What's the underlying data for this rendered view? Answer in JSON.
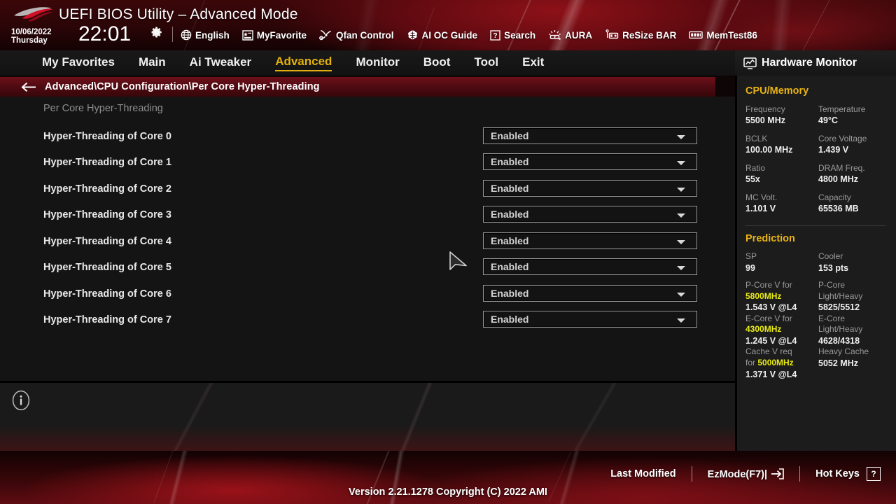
{
  "header": {
    "title": "UEFI BIOS Utility – Advanced Mode",
    "date": "10/06/2022",
    "weekday": "Thursday",
    "time": "22:01",
    "gear_icon": "gear-icon",
    "tools": [
      {
        "label": "English",
        "icon": "globe-icon"
      },
      {
        "label": "MyFavorite",
        "icon": "star-list-icon"
      },
      {
        "label": "Qfan Control",
        "icon": "fan-icon"
      },
      {
        "label": "AI OC Guide",
        "icon": "brain-icon"
      },
      {
        "label": "Search",
        "icon": "question-box-icon"
      },
      {
        "label": "AURA",
        "icon": "aura-light-icon"
      },
      {
        "label": "ReSize BAR",
        "icon": "resize-bar-icon"
      },
      {
        "label": "MemTest86",
        "icon": "memory-icon"
      }
    ]
  },
  "tabs": [
    {
      "label": "My Favorites",
      "active": false
    },
    {
      "label": "Main",
      "active": false
    },
    {
      "label": "Ai Tweaker",
      "active": false
    },
    {
      "label": "Advanced",
      "active": true
    },
    {
      "label": "Monitor",
      "active": false
    },
    {
      "label": "Boot",
      "active": false
    },
    {
      "label": "Tool",
      "active": false
    },
    {
      "label": "Exit",
      "active": false
    }
  ],
  "breadcrumb": {
    "back_icon": "back-arrow-icon",
    "path": "Advanced\\CPU Configuration\\Per Core Hyper-Threading"
  },
  "main": {
    "section_title": "Per Core Hyper-Threading",
    "info_icon": "info-circle-icon",
    "rows": [
      {
        "label": "Hyper-Threading of Core 0",
        "value": "Enabled"
      },
      {
        "label": "Hyper-Threading of Core 1",
        "value": "Enabled"
      },
      {
        "label": "Hyper-Threading of Core 2",
        "value": "Enabled"
      },
      {
        "label": "Hyper-Threading of Core 3",
        "value": "Enabled"
      },
      {
        "label": "Hyper-Threading of Core 4",
        "value": "Enabled"
      },
      {
        "label": "Hyper-Threading of Core 5",
        "value": "Enabled"
      },
      {
        "label": "Hyper-Threading of Core 6",
        "value": "Enabled"
      },
      {
        "label": "Hyper-Threading of Core 7",
        "value": "Enabled"
      }
    ]
  },
  "hardware_monitor": {
    "title": "Hardware Monitor",
    "icon": "monitor-icon",
    "cpu_memory": {
      "section": "CPU/Memory",
      "items": [
        {
          "key": "Frequency",
          "value": "5500 MHz"
        },
        {
          "key": "Temperature",
          "value": "49°C"
        },
        {
          "key": "BCLK",
          "value": "100.00 MHz"
        },
        {
          "key": "Core Voltage",
          "value": "1.439 V"
        },
        {
          "key": "Ratio",
          "value": "55x"
        },
        {
          "key": "DRAM Freq.",
          "value": "4800 MHz"
        },
        {
          "key": "MC Volt.",
          "value": "1.101 V"
        },
        {
          "key": "Capacity",
          "value": "65536 MB"
        }
      ]
    },
    "prediction": {
      "section": "Prediction",
      "sp_key": "SP",
      "sp_value": "99",
      "cooler_key": "Cooler",
      "cooler_value": "153 pts",
      "pcore_key_a": "P-Core V for",
      "pcore_key_b": "5800MHz",
      "pcore_value": "1.543 V @L4",
      "pcore_light_a": "P-Core",
      "pcore_light_b": "Light/Heavy",
      "pcore_light_value": "5825/5512",
      "ecore_key_a": "E-Core V for",
      "ecore_key_b": "4300MHz",
      "ecore_value": "1.245 V @L4",
      "ecore_light_a": "E-Core",
      "ecore_light_b": "Light/Heavy",
      "ecore_light_value": "4628/4318",
      "cache_key_a": "Cache V req",
      "cache_key_b": "for",
      "cache_key_c": "5000MHz",
      "cache_value": "1.371 V @L4",
      "heavy_cache_key": "Heavy Cache",
      "heavy_cache_value": "5052 MHz"
    }
  },
  "footer": {
    "last_modified": "Last Modified",
    "ezmode": "EzMode(F7)|",
    "ezmode_icon": "exit-arrow-icon",
    "hot_keys": "Hot Keys",
    "hot_keys_badge": "?",
    "version": "Version 2.21.1278 Copyright (C) 2022 AMI"
  },
  "colors": {
    "accent_gold": "#e3b10d",
    "accent_yellow": "#e9ec12",
    "panel_bg": "#1c1c1c",
    "content_bg": "#141414",
    "crumb_red": "#6d1019"
  },
  "cursor": {
    "icon": "mouse-pointer-icon"
  }
}
